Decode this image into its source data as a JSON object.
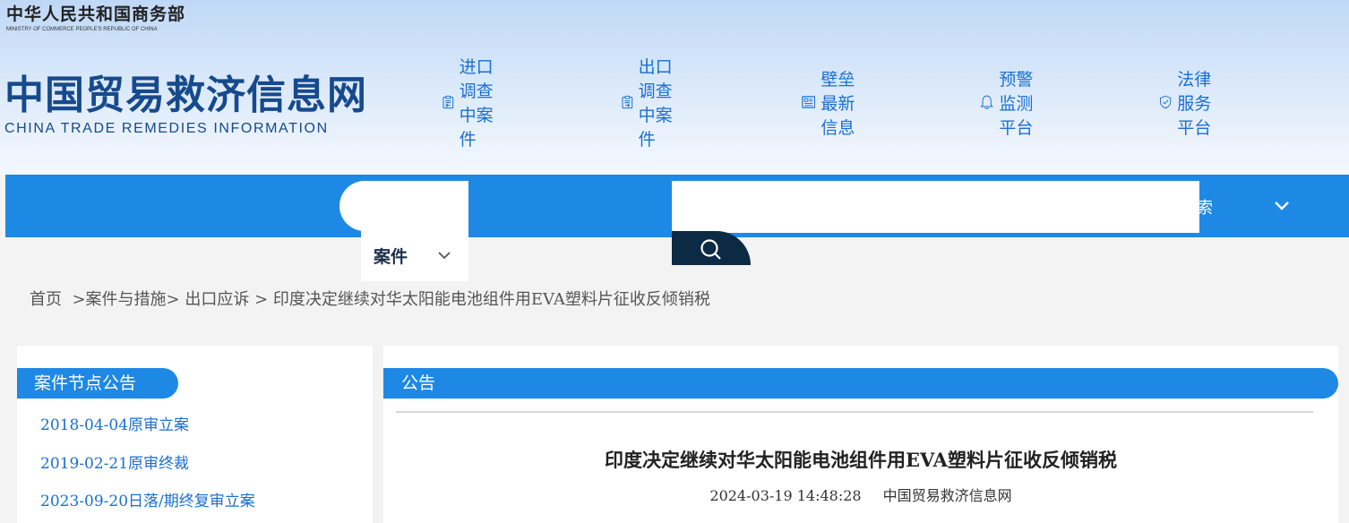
{
  "ministry": {
    "cn": "中华人民共和国商务部",
    "en": "MINISTRY OF COMMERCE PEOPLE'S REPUBLIC OF CHINA"
  },
  "logo": {
    "cn": "中国贸易救济信息网",
    "en": "CHINA TRADE REMEDIES INFORMATION"
  },
  "top_links": [
    {
      "label": "进口调查中案件",
      "icon": "import-clipboard-icon"
    },
    {
      "label": "出口调查中案件",
      "icon": "export-clipboard-icon"
    },
    {
      "label": "壁垒最新信息",
      "icon": "document-list-icon"
    },
    {
      "label": "预警监测平台",
      "icon": "bell-icon"
    },
    {
      "label": "法律服务平台",
      "icon": "shield-check-icon"
    }
  ],
  "nav": {
    "case_tab": "案件",
    "search_label_partial": "搜索",
    "search_value": ""
  },
  "breadcrumb": [
    "首页",
    "案件与措施",
    "出口应诉",
    "印度决定继续对华太阳能电池组件用EVA塑料片征收反倾销税"
  ],
  "left_panel": {
    "title": "案件节点公告",
    "items": [
      "2018-04-04原审立案",
      "2019-02-21原审终裁",
      "2023-09-20日落/期终复审立案"
    ]
  },
  "right_panel": {
    "title": "公告",
    "headline": "印度决定继续对华太阳能电池组件用EVA塑料片征收反倾销税",
    "datetime": "2024-03-19 14:48:28",
    "source": "中国贸易救济信息网"
  },
  "colors": {
    "brand_blue": "#1e88e5",
    "logo_blue": "#174a8c",
    "link_blue": "#1a6fd1",
    "dark_navy": "#0d2a45"
  }
}
